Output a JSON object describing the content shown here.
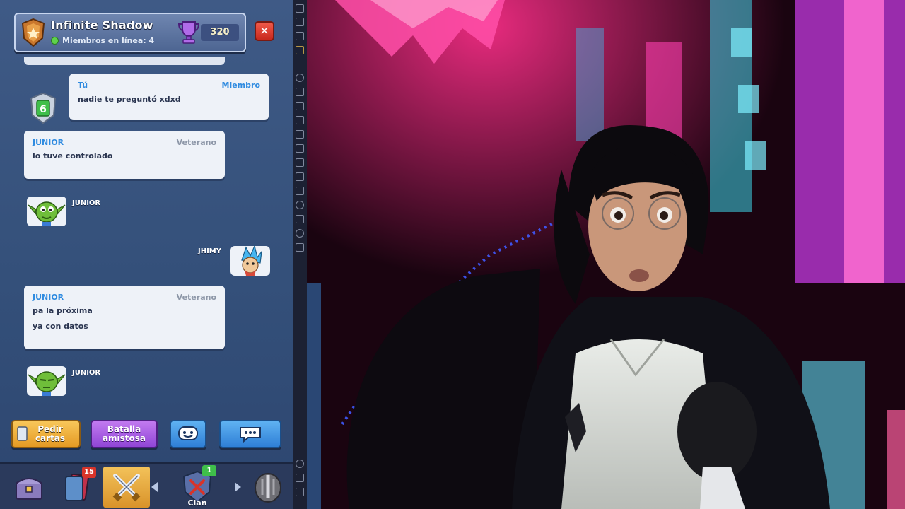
{
  "header": {
    "clan_name": "Infinite Shadow",
    "online_label": "Miembros en línea: 4",
    "trophies": "320"
  },
  "chat": {
    "message_1": {
      "sender": "Tú",
      "role": "Miembro",
      "text": "nadie te preguntó xdxd",
      "level": "6"
    },
    "message_2": {
      "sender": "JUNIOR",
      "role": "Veterano",
      "text": "lo tuve controlado"
    },
    "emote_1": {
      "sender": "JUNIOR"
    },
    "emote_2": {
      "sender": "JHIMY"
    },
    "message_3": {
      "sender": "JUNIOR",
      "role": "Veterano",
      "lines": [
        "pa la próxima",
        "ya con datos"
      ]
    },
    "emote_3": {
      "sender": "JUNIOR"
    }
  },
  "actions": {
    "request_cards": "Pedir cartas",
    "friendly_battle": "Batalla amistosa"
  },
  "bottom_nav": {
    "cards_badge": "15",
    "clan_badge": "1",
    "clan_label": "Clan"
  },
  "colors": {
    "accent_blue": "#2f8be0",
    "role_grey": "#8d97a8",
    "request_gold": "#f2b23a",
    "battle_purple": "#a957e6",
    "emote_blue": "#3f9be8",
    "online_green": "#5fd24b",
    "close_red": "#d8342a"
  },
  "icons": [
    "clan-badge-icon",
    "trophy-icon",
    "close-icon",
    "level-shield-icon",
    "goblin-emote-icon",
    "wizard-emote-icon",
    "cards-icon",
    "emoji-icon",
    "chat-icon",
    "chest-icon",
    "deck-icon",
    "battle-swords-icon",
    "clan-shield-icon",
    "tournament-icon"
  ]
}
